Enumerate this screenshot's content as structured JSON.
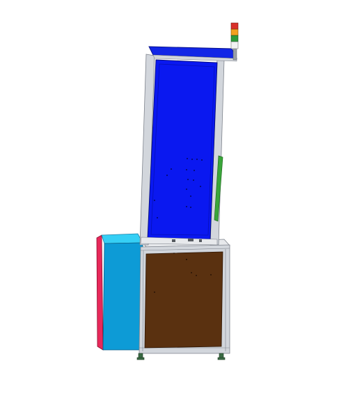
{
  "scene": {
    "kind": "cad-assembly-view",
    "background": "#ffffff",
    "colors": {
      "upper_panel": "#0a18f0",
      "upper_panel_dark": "#0610b8",
      "roof": "#1226e6",
      "frame": "#d2d6dc",
      "frame_line": "#7e838c",
      "lower_panel": "#5a3110",
      "side_cabinet_front": "#0d9bd6",
      "side_cabinet_top": "#35cff5",
      "side_cabinet_edge": "#e8285a",
      "green_rail": "#3aa63a",
      "feet": "#3a6b45",
      "light_red": "#d9302a",
      "light_orange": "#f2a020",
      "light_green": "#2e9a3a",
      "light_white": "#f2f2f2",
      "light_pole": "#9aa0a6"
    },
    "signal_tower_lights": [
      "red",
      "orange",
      "green",
      "white"
    ]
  }
}
